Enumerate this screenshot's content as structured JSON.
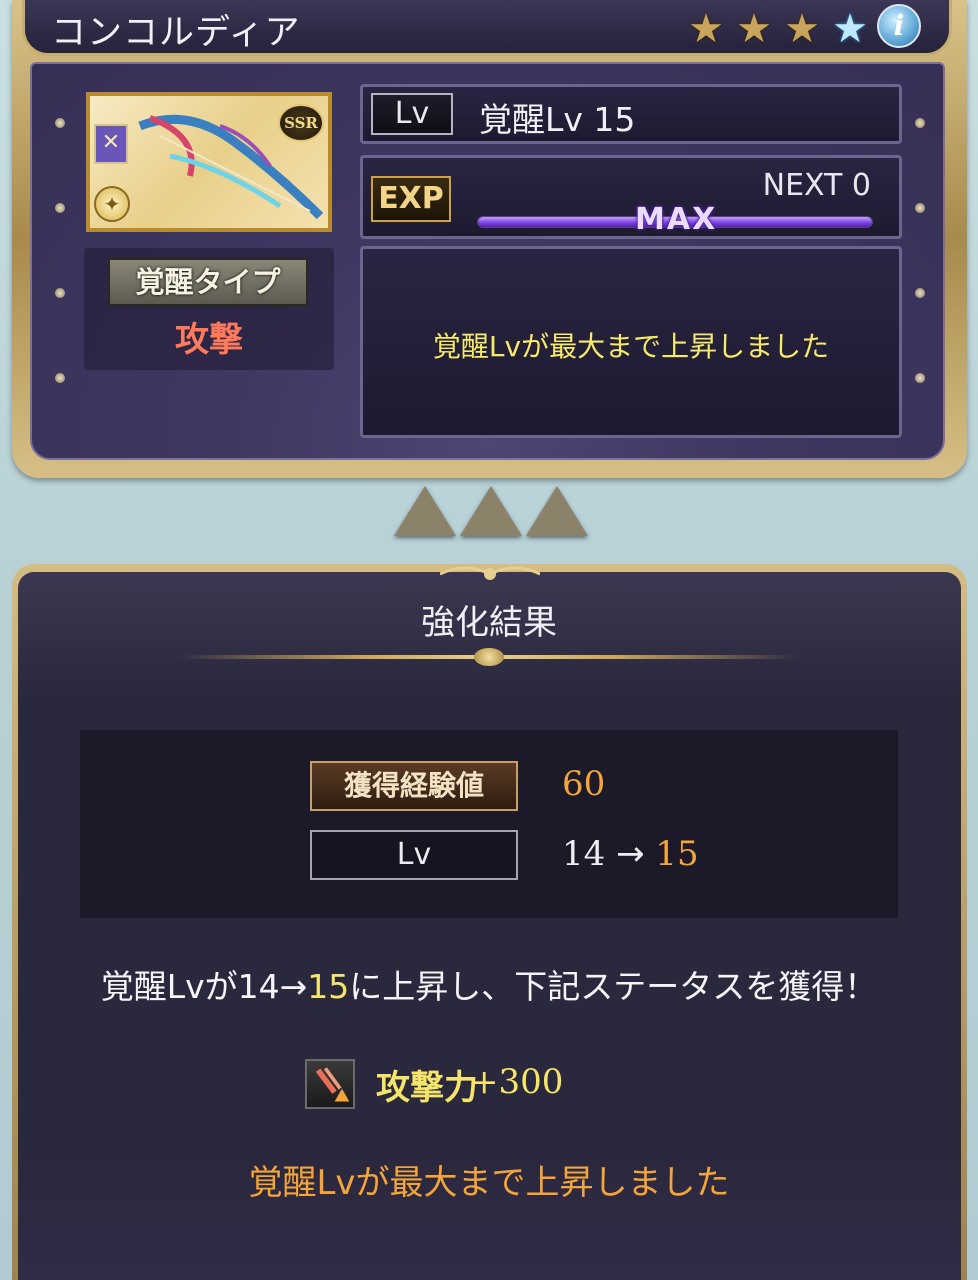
{
  "header": {
    "title": "コンコルディア",
    "stars": [
      "★",
      "★",
      "★",
      "★"
    ],
    "info_label": "i"
  },
  "card": {
    "rarity": "SSR",
    "type_symbol": "✕",
    "element_symbol": "✦"
  },
  "status": {
    "awaken_type_label": "覚醒タイプ",
    "awaken_type_value": "攻撃",
    "lv_label": "Lv",
    "lv_value": "覚醒Lv 15",
    "exp_label": "EXP",
    "next_text": "NEXT 0",
    "exp_progress": 1.0,
    "max_label": "MAX",
    "message": "覚醒Lvが最大まで上昇しました"
  },
  "result": {
    "title": "強化結果",
    "gain_label": "獲得経験値",
    "gain_value": "60",
    "lv_label": "Lv",
    "lv_from": "14",
    "lv_arrow": "→",
    "lv_to": "15",
    "summary_prefix": "覚醒Lvが14→",
    "summary_highlight": "15",
    "summary_suffix": "に上昇し、下記ステータスを獲得！",
    "stat_name": "攻撃力",
    "stat_value": "+300",
    "final_message": "覚醒Lvが最大まで上昇しました"
  },
  "colors": {
    "accent_gold": "#f3a43b",
    "accent_yellow": "#f5e56a",
    "awaken_type": "#ff7a5a",
    "exp_fill": "#7a3fe0"
  }
}
